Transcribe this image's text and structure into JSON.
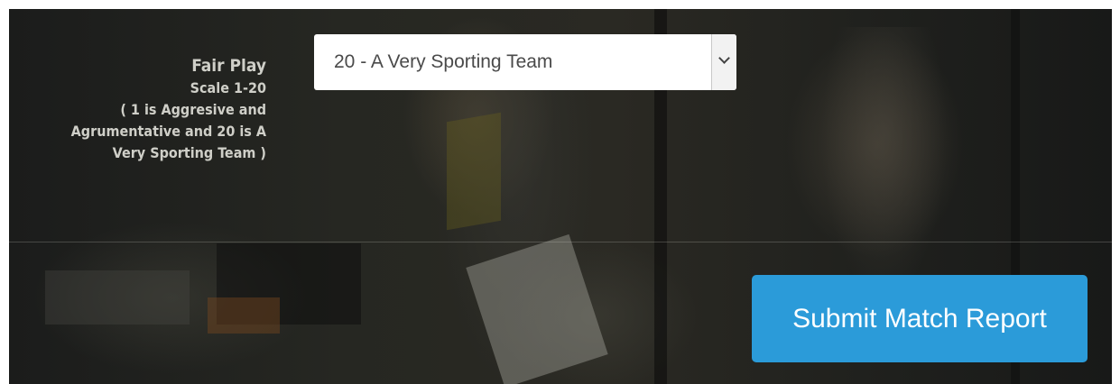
{
  "form": {
    "fair_play": {
      "label": "Fair Play",
      "scale": "Scale 1-20",
      "help_line1": "( 1 is Aggresive and",
      "help_line2": "Agrumentative and 20 is A",
      "help_line3": "Very Sporting Team )",
      "selected_value": "20 - A Very Sporting Team"
    },
    "submit_label": "Submit Match Report"
  },
  "colors": {
    "button": "#2b9bd9",
    "label_text": "#cfcfc8",
    "select_text": "#4a4a4a"
  }
}
